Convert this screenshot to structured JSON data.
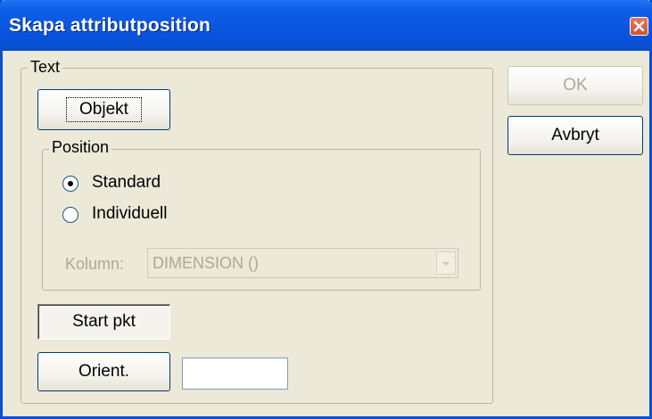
{
  "dialog": {
    "title": "Skapa attributposition",
    "close_icon": "close-icon"
  },
  "text_group": {
    "legend": "Text",
    "objekt_button": "Objekt"
  },
  "position_group": {
    "legend": "Position",
    "options": [
      {
        "label": "Standard",
        "selected": true
      },
      {
        "label": "Individuell",
        "selected": false
      }
    ],
    "kolumn_label": "Kolumn:",
    "kolumn_value": "DIMENSION ()"
  },
  "start_pkt": "Start pkt",
  "orient_button": "Orient.",
  "orient_value": "",
  "ok_button": "OK",
  "cancel_button": "Avbryt",
  "colors": {
    "titlebar": "#0a56e0",
    "dialog_bg": "#ece9d8",
    "close_button": "#d2532f",
    "disabled_text": "#aca899"
  }
}
